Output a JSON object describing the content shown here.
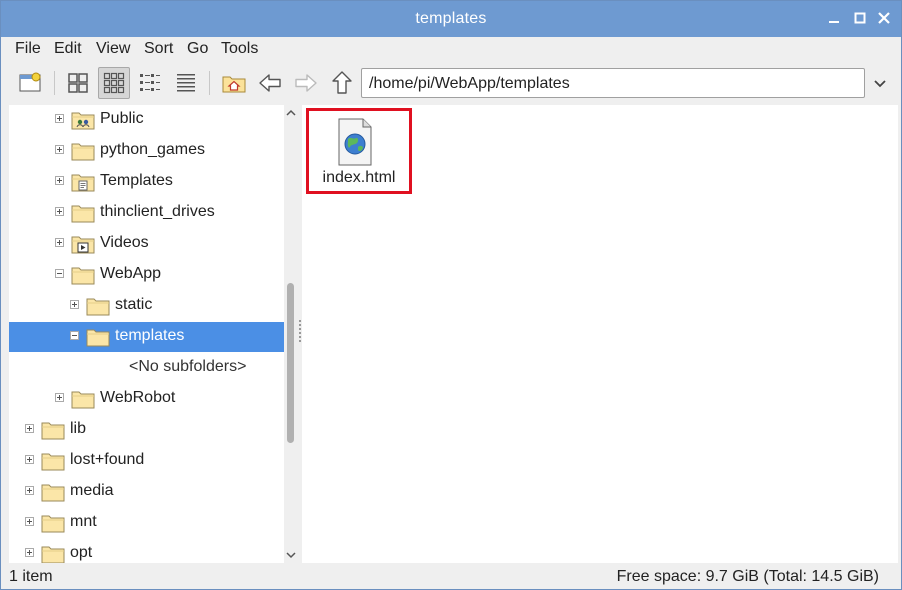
{
  "window": {
    "title": "templates"
  },
  "menu": [
    "File",
    "Edit",
    "View",
    "Sort",
    "Go",
    "Tools"
  ],
  "toolbar": {
    "path": "/home/pi/WebApp/templates"
  },
  "tree": [
    {
      "label": "Public",
      "icon": "public-folder-icon",
      "expander": "plus"
    },
    {
      "label": "python_games",
      "icon": "folder-icon",
      "expander": "plus"
    },
    {
      "label": "Templates",
      "icon": "templates-folder-icon",
      "expander": "plus"
    },
    {
      "label": "thinclient_drives",
      "icon": "folder-icon",
      "expander": "plus"
    },
    {
      "label": "Videos",
      "icon": "videos-folder-icon",
      "expander": "plus"
    },
    {
      "label": "WebApp",
      "icon": "folder-icon",
      "expander": "minus"
    },
    {
      "label": "static",
      "icon": "folder-icon",
      "expander": "plus"
    },
    {
      "label": "templates",
      "icon": "folder-icon",
      "expander": "minus",
      "selected": true
    },
    {
      "label": "<No subfolders>",
      "icon": "",
      "expander": "none"
    },
    {
      "label": "WebRobot",
      "icon": "folder-icon",
      "expander": "plus"
    },
    {
      "label": "lib",
      "icon": "folder-icon",
      "expander": "plus"
    },
    {
      "label": "lost+found",
      "icon": "folder-icon",
      "expander": "plus"
    },
    {
      "label": "media",
      "icon": "folder-icon",
      "expander": "plus"
    },
    {
      "label": "mnt",
      "icon": "folder-icon",
      "expander": "plus"
    },
    {
      "label": "opt",
      "icon": "folder-icon",
      "expander": "plus"
    }
  ],
  "files": [
    {
      "name": "index.html",
      "icon": "html-file-icon"
    }
  ],
  "status": {
    "count": "1 item",
    "free_space": "Free space: 9.7 GiB (Total: 14.5 GiB)"
  },
  "colors": {
    "titlebar": "#6e9ad1",
    "selection": "#4b8fe5",
    "highlight_box": "#e01020"
  }
}
